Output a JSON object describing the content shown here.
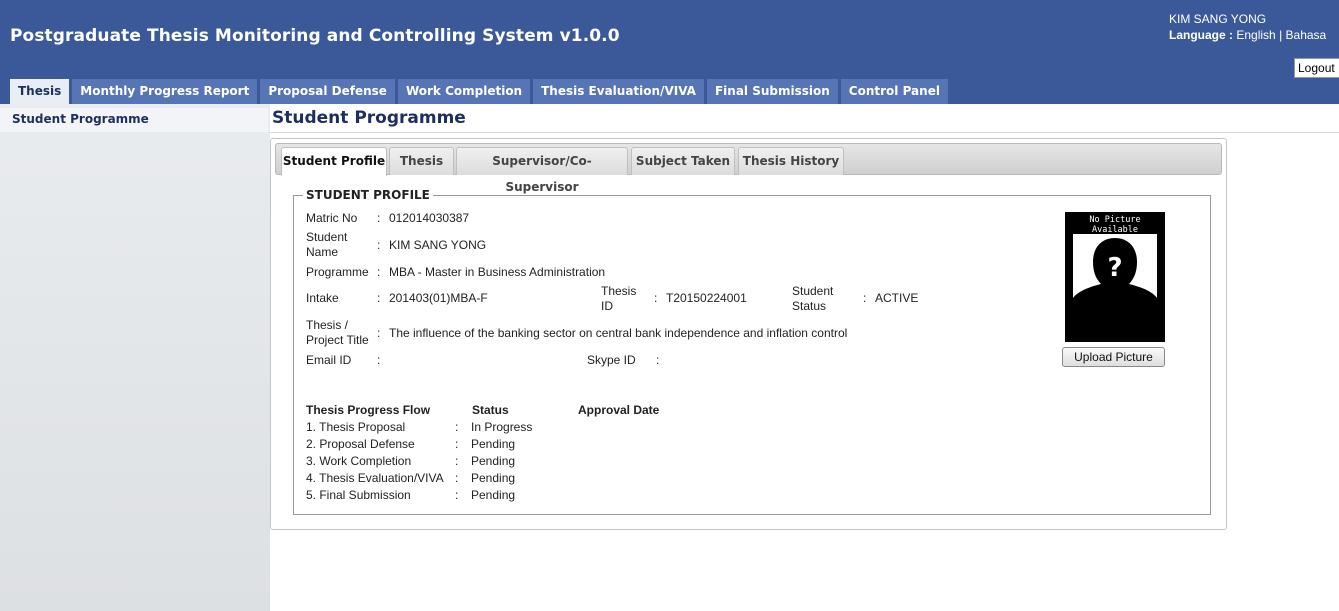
{
  "header": {
    "app_title": "Postgraduate Thesis Monitoring and Controlling System v1.0.0",
    "user_name": "KIM SANG YONG",
    "language_label": "Language :",
    "lang_english": "English",
    "lang_separator": "|",
    "lang_bahasa": "Bahasa",
    "logout_label": "Logout",
    "brand_color": "#3b5998"
  },
  "main_tabs": [
    {
      "label": "Thesis",
      "active": true
    },
    {
      "label": "Monthly Progress Report"
    },
    {
      "label": "Proposal Defense"
    },
    {
      "label": "Work Completion"
    },
    {
      "label": "Thesis Evaluation/VIVA"
    },
    {
      "label": "Final Submission"
    },
    {
      "label": "Control Panel"
    }
  ],
  "sidebar": {
    "items": [
      {
        "label": "Student Programme"
      }
    ]
  },
  "page": {
    "title": "Student Programme"
  },
  "sub_tabs": [
    {
      "label": "Student Profile",
      "active": true
    },
    {
      "label": "Thesis"
    },
    {
      "label": "Supervisor/Co-Supervisor"
    },
    {
      "label": "Subject Taken"
    },
    {
      "label": "Thesis History"
    }
  ],
  "profile": {
    "legend": "STUDENT PROFILE",
    "colon": ":",
    "matric_label": "Matric No",
    "matric_value": "012014030387",
    "name_label_1": "Student",
    "name_label_2": "Name",
    "name_value": "KIM SANG YONG",
    "programme_label": "Programme",
    "programme_value": "MBA - Master in Business Administration",
    "intake_label": "Intake",
    "intake_value": "201403(01)MBA-F",
    "thesis_id_label_1": "Thesis",
    "thesis_id_label_2": "ID",
    "thesis_id_value": "T20150224001",
    "status_label_1": "Student",
    "status_label_2": "Status",
    "status_value": "ACTIVE",
    "project_label_1": "Thesis /",
    "project_label_2": "Project Title",
    "project_value": "The influence of the banking sector on central bank independence and inflation control",
    "email_label": "Email ID",
    "email_value": "",
    "skype_label": "Skype ID",
    "skype_value": "",
    "photo_caption": "No Picture Available",
    "upload_label": "Upload Picture"
  },
  "progress": {
    "headers": {
      "flow": "Thesis Progress Flow",
      "status": "Status",
      "approval": "Approval Date"
    },
    "rows": [
      {
        "step": "1. Thesis Proposal",
        "status": "In Progress",
        "date": ""
      },
      {
        "step": "2. Proposal Defense",
        "status": "Pending",
        "date": ""
      },
      {
        "step": "3. Work Completion",
        "status": "Pending",
        "date": ""
      },
      {
        "step": "4. Thesis Evaluation/VIVA",
        "status": "Pending",
        "date": ""
      },
      {
        "step": "5. Final Submission",
        "status": "Pending",
        "date": ""
      }
    ]
  }
}
